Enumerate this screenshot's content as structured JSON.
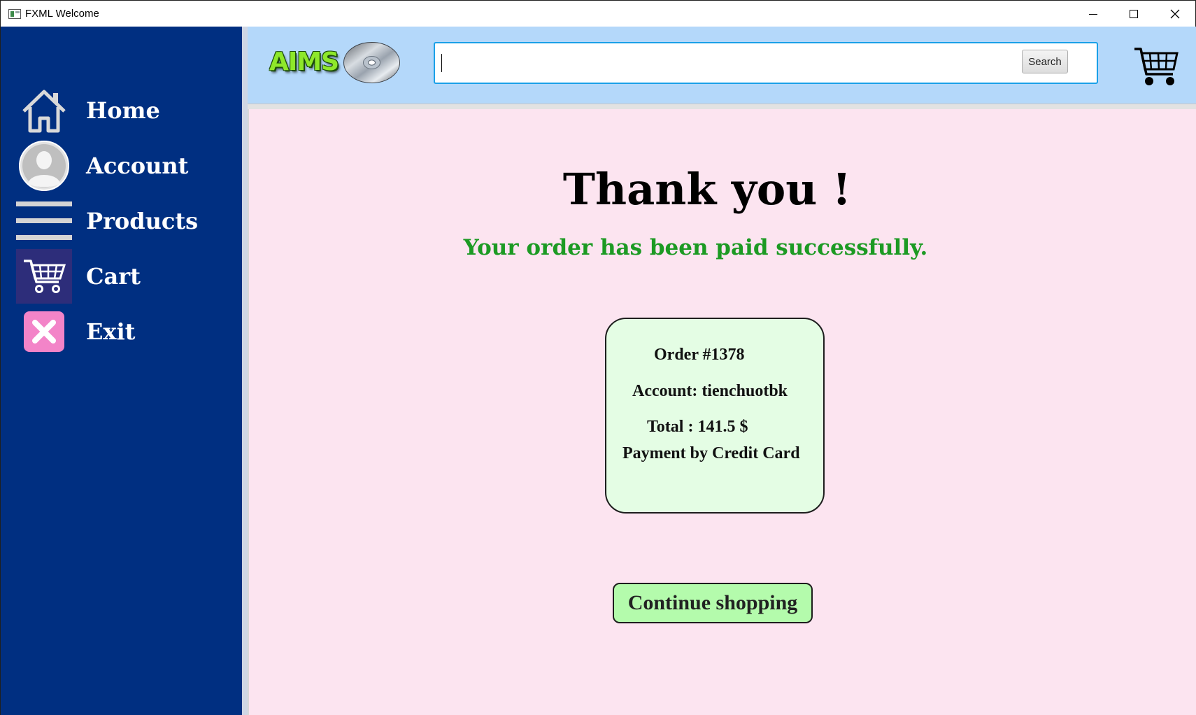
{
  "window": {
    "title": "FXML Welcome"
  },
  "sidebar": {
    "items": [
      {
        "label": "Home",
        "icon": "home-icon"
      },
      {
        "label": "Account",
        "icon": "user-icon"
      },
      {
        "label": "Products",
        "icon": "menu-icon"
      },
      {
        "label": "Cart",
        "icon": "cart-icon",
        "active": true
      },
      {
        "label": "Exit",
        "icon": "close-icon"
      }
    ]
  },
  "header": {
    "logo_text": "AIMS",
    "search": {
      "value": "",
      "button_label": "Search"
    }
  },
  "main": {
    "heading": "Thank you !",
    "message": "Your order has been paid successfully.",
    "order": {
      "number": "Order #1378",
      "account": "Account: tienchuotbk",
      "total": "Total : 141.5 $",
      "payment": "Payment by Credit Card"
    },
    "continue_label": "Continue shopping"
  },
  "colors": {
    "sidebar_bg": "#002f81",
    "header_bg": "#b4d8fa",
    "main_bg": "#fce4f0",
    "success_text": "#1c9a23",
    "card_bg": "#e4fde4",
    "button_bg": "#b4fbac",
    "search_border": "#1aa0e8"
  }
}
